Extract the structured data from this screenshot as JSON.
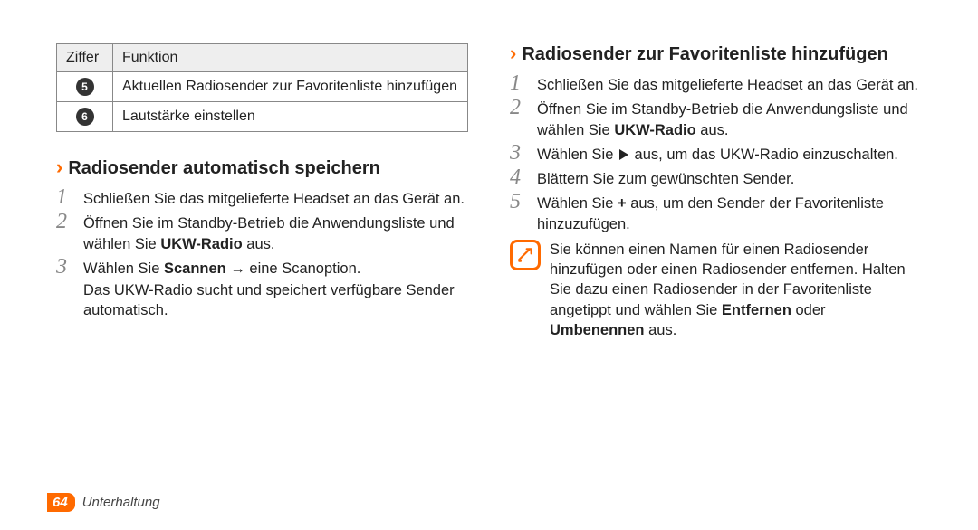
{
  "table": {
    "headers": {
      "col1": "Ziffer",
      "col2": "Funktion"
    },
    "rows": [
      {
        "num": "5",
        "desc": "Aktuellen Radiosender zur Favoritenliste hinzufügen"
      },
      {
        "num": "6",
        "desc": "Lautstärke einstellen"
      }
    ]
  },
  "section_auto": {
    "title": "Radiosender automatisch speichern",
    "steps": [
      {
        "n": "1",
        "text": "Schließen Sie das mitgelieferte Headset an das Gerät an."
      },
      {
        "n": "2",
        "pre": "Öffnen Sie im Standby-Betrieb die Anwendungsliste und wählen Sie ",
        "bold": "UKW-Radio",
        "post": " aus."
      },
      {
        "n": "3",
        "pre": "Wählen Sie ",
        "bold": "Scannen",
        "post": " → eine Scanoption.",
        "sub": "Das UKW-Radio sucht und speichert verfügbare Sender automatisch."
      }
    ]
  },
  "section_fav": {
    "title": "Radiosender zur Favoritenliste hinzufügen",
    "steps": [
      {
        "n": "1",
        "text": "Schließen Sie das mitgelieferte Headset an das Gerät an."
      },
      {
        "n": "2",
        "pre": "Öffnen Sie im Standby-Betrieb die Anwendungsliste und wählen Sie ",
        "bold": "UKW-Radio",
        "post": " aus."
      },
      {
        "n": "3",
        "pre": "Wählen Sie ",
        "icon": "play",
        "post": " aus, um das UKW-Radio einzuschalten."
      },
      {
        "n": "4",
        "text": "Blättern Sie zum gewünschten Sender."
      },
      {
        "n": "5",
        "pre": "Wählen Sie ",
        "bold": "+",
        "post": " aus, um den Sender der Favoritenliste hinzuzufügen."
      }
    ],
    "note": {
      "pre": "Sie können einen Namen für einen Radiosender hinzufügen oder einen Radiosender entfernen. Halten Sie dazu einen Radiosender in der Favoritenliste angetippt und wählen Sie ",
      "bold1": "Entfernen",
      "mid": " oder ",
      "bold2": "Umbenennen",
      "post": " aus."
    }
  },
  "footer": {
    "page": "64",
    "section": "Unterhaltung"
  }
}
